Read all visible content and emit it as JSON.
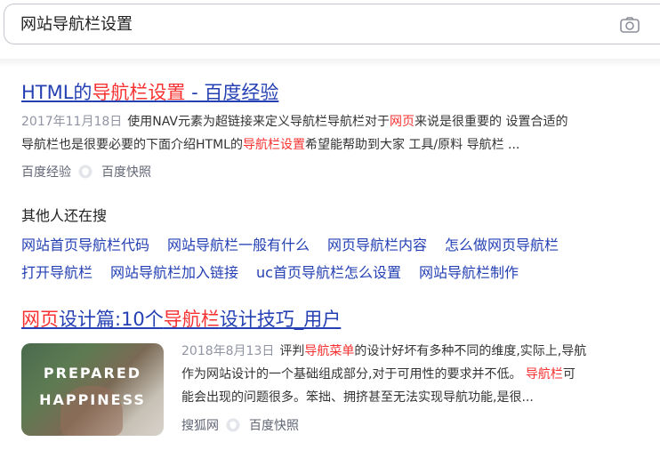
{
  "search": {
    "query": "网站导航栏设置",
    "camera_icon": "camera-icon"
  },
  "result1": {
    "title_prefix": "HTML的",
    "title_hl": "导航栏设置",
    "title_suffix": " - 百度经验",
    "date": "2017年11月18日",
    "line1_a": "使用NAV元素为超链接来定义导航栏导航栏对于",
    "line1_hl": "网页",
    "line1_b": "来说是很重要的 设置合适的",
    "line2_a": "导航栏也是很要必要的下面介绍HTML的",
    "line2_hl": "导航栏设置",
    "line2_b": "希望能帮助到大家 工具/原料 导航栏 ...",
    "source": "百度经验",
    "snapshot": "百度快照"
  },
  "others": {
    "heading": "其他人还在搜",
    "row1": [
      "网站首页导航栏代码",
      "网站导航栏一般有什么",
      "网页导航栏内容",
      "怎么做网页导航栏"
    ],
    "row2": [
      "打开导航栏",
      "网站导航栏加入链接",
      "uc首页导航栏怎么设置",
      "网站导航栏制作"
    ]
  },
  "result2": {
    "title_hl1": "网页",
    "title_mid": "设计篇:10个",
    "title_hl2": "导航栏",
    "title_suffix": "设计技巧_用户",
    "thumb_line1": "PREPARED",
    "thumb_line2": "HAPPINESS",
    "date": "2018年8月13日",
    "line1_a": "评判",
    "line1_hl": "导航菜单",
    "line1_b": "的设计好坏有多种不同的维度,实际上,导航",
    "line2_a": "作为网站设计的一个基础组成部分,对于可用性的要求并不低。",
    "line2_hl": "导航栏",
    "line2_b": "可",
    "line3": "能会出现的问题很多。笨拙、拥挤甚至无法实现导航功能,是很...",
    "source": "搜狐网",
    "snapshot": "百度快照"
  },
  "colors": {
    "link": "#2440b3",
    "highlight": "#f73131",
    "meta": "#9195a3"
  }
}
